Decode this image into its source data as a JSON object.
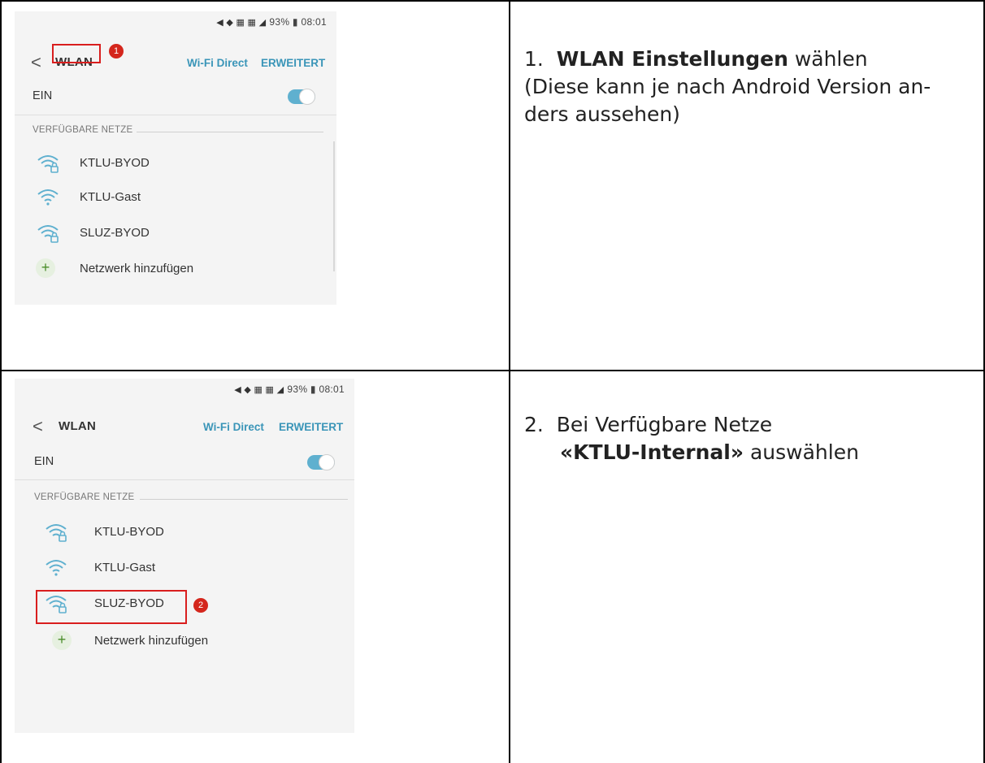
{
  "phone": {
    "status_text": "93% ▮ 08:01",
    "status_icons": "◀ ◆ ▦ ▦ ◢",
    "back_glyph": "<",
    "title": "WLAN",
    "wifi_direct": "Wi-Fi Direct",
    "extended": "ERWEITERT",
    "wifi_on_label": "EIN",
    "section_label": "VERFÜGBARE NETZE",
    "networks": [
      {
        "name": "KTLU-BYOD",
        "locked": true
      },
      {
        "name": "KTLU-Gast",
        "locked": false
      },
      {
        "name": "SLUZ-BYOD",
        "locked": true
      }
    ],
    "add_network": "Netzwerk hinzufügen",
    "accent_color": "#3a95b8"
  },
  "steps": [
    {
      "number": "1.",
      "bold": "WLAN Einstellungen",
      "rest": " wählen",
      "line2": "(Diese kann je nach Android Version an-",
      "line3": "ders aussehen)",
      "badge": "1"
    },
    {
      "number": "2.",
      "line1": "Bei Verfügbare Netze",
      "bold": "«KTLU-Internal»",
      "rest": " auswählen",
      "badge": "2"
    }
  ]
}
